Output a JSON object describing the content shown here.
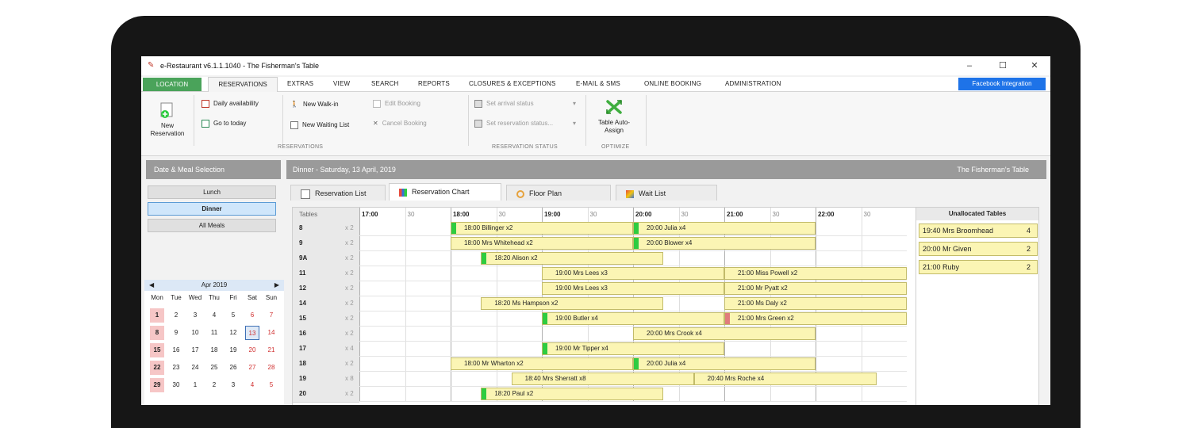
{
  "window": {
    "title": "e-Restaurant v6.1.1.1040 - The Fisherman's Table",
    "controls": {
      "minimize": "–",
      "maximize": "☐",
      "close": "✕"
    }
  },
  "menu": {
    "location": "LOCATION",
    "reservations": "RESERVATIONS",
    "items": [
      "EXTRAS",
      "VIEW",
      "SEARCH",
      "REPORTS",
      "CLOSURES & EXCEPTIONS",
      "E-MAIL & SMS",
      "ONLINE BOOKING",
      "ADMINISTRATION"
    ],
    "facebook": "Facebook Integration"
  },
  "ribbon": {
    "new_reservation": "New Reservation",
    "daily_availability": "Daily availability",
    "go_to_today": "Go to today",
    "new_walk_in": "New Walk-in",
    "new_waiting_list": "New Waiting List",
    "edit_booking": "Edit Booking",
    "cancel_booking": "Cancel Booking",
    "set_arrival_status": "Set arrival status",
    "set_reservation_status": "Set reservation status...",
    "table_auto_assign": "Table Auto-Assign",
    "group_reservations": "RESERVATIONS",
    "group_status": "RESERVATION STATUS",
    "group_optimize": "OPTIMIZE"
  },
  "left_panel": {
    "header": "Date & Meal Selection",
    "meals": [
      "Lunch",
      "Dinner",
      "All Meals"
    ],
    "selected_meal": "Dinner"
  },
  "calendar": {
    "month": "Apr 2019",
    "prev": "◀",
    "next": "▶",
    "dow": [
      "Mon",
      "Tue",
      "Wed",
      "Thu",
      "Fri",
      "Sat",
      "Sun"
    ],
    "weeks": [
      [
        "1",
        "2",
        "3",
        "4",
        "5",
        "6",
        "7"
      ],
      [
        "8",
        "9",
        "10",
        "11",
        "12",
        "13",
        "14"
      ],
      [
        "15",
        "16",
        "17",
        "18",
        "19",
        "20",
        "21"
      ],
      [
        "22",
        "23",
        "24",
        "25",
        "26",
        "27",
        "28"
      ],
      [
        "29",
        "30",
        "1",
        "2",
        "3",
        "4",
        "5"
      ]
    ],
    "today": "13"
  },
  "main_header": {
    "meal_date": "Dinner - Saturday, 13 April, 2019",
    "restaurant": "The Fisherman's Table"
  },
  "tabs": [
    "Reservation List",
    "Reservation Chart",
    "Floor Plan",
    "Wait List"
  ],
  "active_tab": "Reservation Chart",
  "chart": {
    "tables_label": "Tables",
    "time_headers": [
      "17:00",
      "30",
      "18:00",
      "30",
      "19:00",
      "30",
      "20:00",
      "30",
      "21:00",
      "30",
      "22:00",
      "30"
    ],
    "tables": [
      {
        "name": "8",
        "cap": "x 2"
      },
      {
        "name": "9",
        "cap": "x 2"
      },
      {
        "name": "9A",
        "cap": "x 2"
      },
      {
        "name": "11",
        "cap": "x 2"
      },
      {
        "name": "12",
        "cap": "x 2"
      },
      {
        "name": "14",
        "cap": "x 2"
      },
      {
        "name": "15",
        "cap": "x 2"
      },
      {
        "name": "16",
        "cap": "x 2"
      },
      {
        "name": "17",
        "cap": "x 4"
      },
      {
        "name": "18",
        "cap": "x 2"
      },
      {
        "name": "19",
        "cap": "x 8"
      },
      {
        "name": "20",
        "cap": "x 2"
      }
    ],
    "bookings": [
      {
        "row": 0,
        "start": "18:00",
        "end": "20:00",
        "label": "18:00  Billinger x2",
        "status": "#2ecc40"
      },
      {
        "row": 0,
        "start": "20:00",
        "end": "22:00",
        "label": "20:00  Julia x4",
        "status": "#2ecc40"
      },
      {
        "row": 1,
        "start": "18:00",
        "end": "20:00",
        "label": "18:00  Mrs Whitehead x2",
        "status": ""
      },
      {
        "row": 1,
        "start": "20:00",
        "end": "22:00",
        "label": "20:00  Blower x4",
        "status": "#2ecc40"
      },
      {
        "row": 2,
        "start": "18:20",
        "end": "20:20",
        "label": "18:20  Alison x2",
        "status": "#2ecc40"
      },
      {
        "row": 3,
        "start": "19:00",
        "end": "21:00",
        "label": "19:00  Mrs Lees x3",
        "status": ""
      },
      {
        "row": 3,
        "start": "21:00",
        "end": "23:00",
        "label": "21:00  Miss Powell x2",
        "status": ""
      },
      {
        "row": 4,
        "start": "19:00",
        "end": "21:00",
        "label": "19:00  Mrs Lees x3",
        "status": ""
      },
      {
        "row": 4,
        "start": "21:00",
        "end": "23:00",
        "label": "21:00  Mr Pyatt x2",
        "status": ""
      },
      {
        "row": 5,
        "start": "18:20",
        "end": "20:20",
        "label": "18:20  Ms Hampson x2",
        "status": ""
      },
      {
        "row": 5,
        "start": "21:00",
        "end": "23:00",
        "label": "21:00  Ms Daly x2",
        "status": ""
      },
      {
        "row": 6,
        "start": "19:00",
        "end": "21:00",
        "label": "19:00  Butler x4",
        "status": "#2ecc40"
      },
      {
        "row": 6,
        "start": "21:00",
        "end": "23:00",
        "label": "21:00  Mrs Green x2",
        "status": "#e07c7c"
      },
      {
        "row": 7,
        "start": "20:00",
        "end": "22:00",
        "label": "20:00  Mrs Crook x4",
        "status": ""
      },
      {
        "row": 8,
        "start": "19:00",
        "end": "21:00",
        "label": "19:00  Mr Tipper x4",
        "status": "#2ecc40"
      },
      {
        "row": 9,
        "start": "18:00",
        "end": "20:00",
        "label": "18:00  Mr Wharton x2",
        "status": ""
      },
      {
        "row": 9,
        "start": "20:00",
        "end": "22:00",
        "label": "20:00  Julia x4",
        "status": "#2ecc40"
      },
      {
        "row": 10,
        "start": "18:40",
        "end": "20:40",
        "label": "18:40  Mrs Sherratt x8",
        "status": ""
      },
      {
        "row": 10,
        "start": "20:40",
        "end": "22:40",
        "label": "20:40  Mrs Roche x4",
        "status": ""
      },
      {
        "row": 11,
        "start": "18:20",
        "end": "20:20",
        "label": "18:20  Paul x2",
        "status": "#2ecc40"
      }
    ]
  },
  "unallocated": {
    "title": "Unallocated Tables",
    "items": [
      {
        "name": "19:40 Mrs Broomhead",
        "count": "4"
      },
      {
        "name": "20:00 Mr Given",
        "count": "2"
      },
      {
        "name": "21:00 Ruby",
        "count": "2"
      }
    ]
  },
  "colors": {
    "booking_fill": "#fbf5b4",
    "arrived": "#2ecc40",
    "late": "#e07c7c",
    "location_tab": "#4aa35a",
    "facebook": "#1e73e8"
  }
}
